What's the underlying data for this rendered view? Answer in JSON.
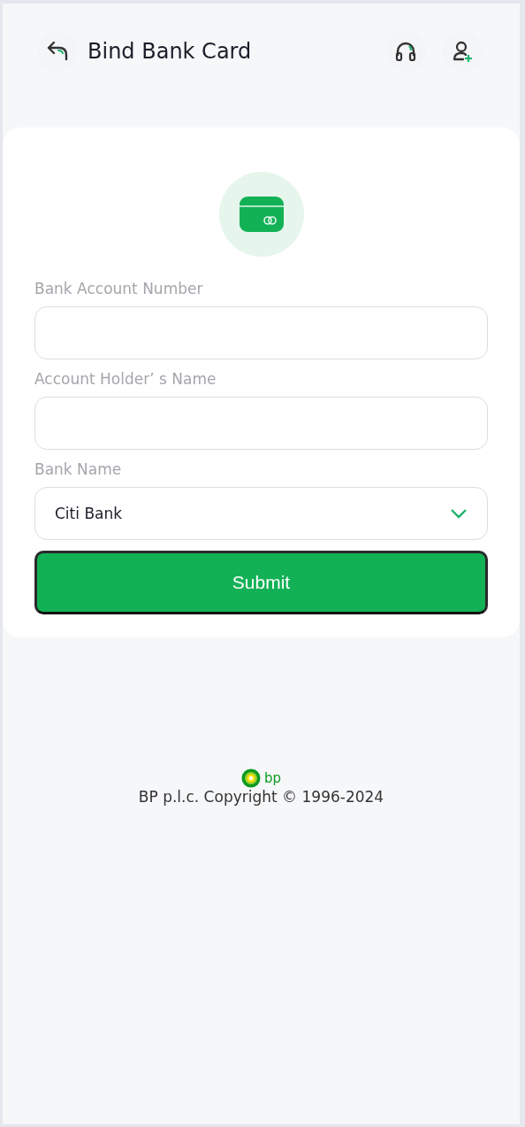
{
  "header": {
    "title": "Bind Bank Card"
  },
  "form": {
    "fields": [
      {
        "kind": "input",
        "label": "Bank Account Number"
      },
      {
        "kind": "input",
        "label": "Account Holder’ s Name"
      },
      {
        "kind": "select",
        "label": "Bank Name",
        "value": "Citi Bank"
      }
    ],
    "submit": "Submit"
  },
  "footer": {
    "logo_text": "bp",
    "copyright": "BP p.l.c. Copyright © 1996-2024"
  }
}
